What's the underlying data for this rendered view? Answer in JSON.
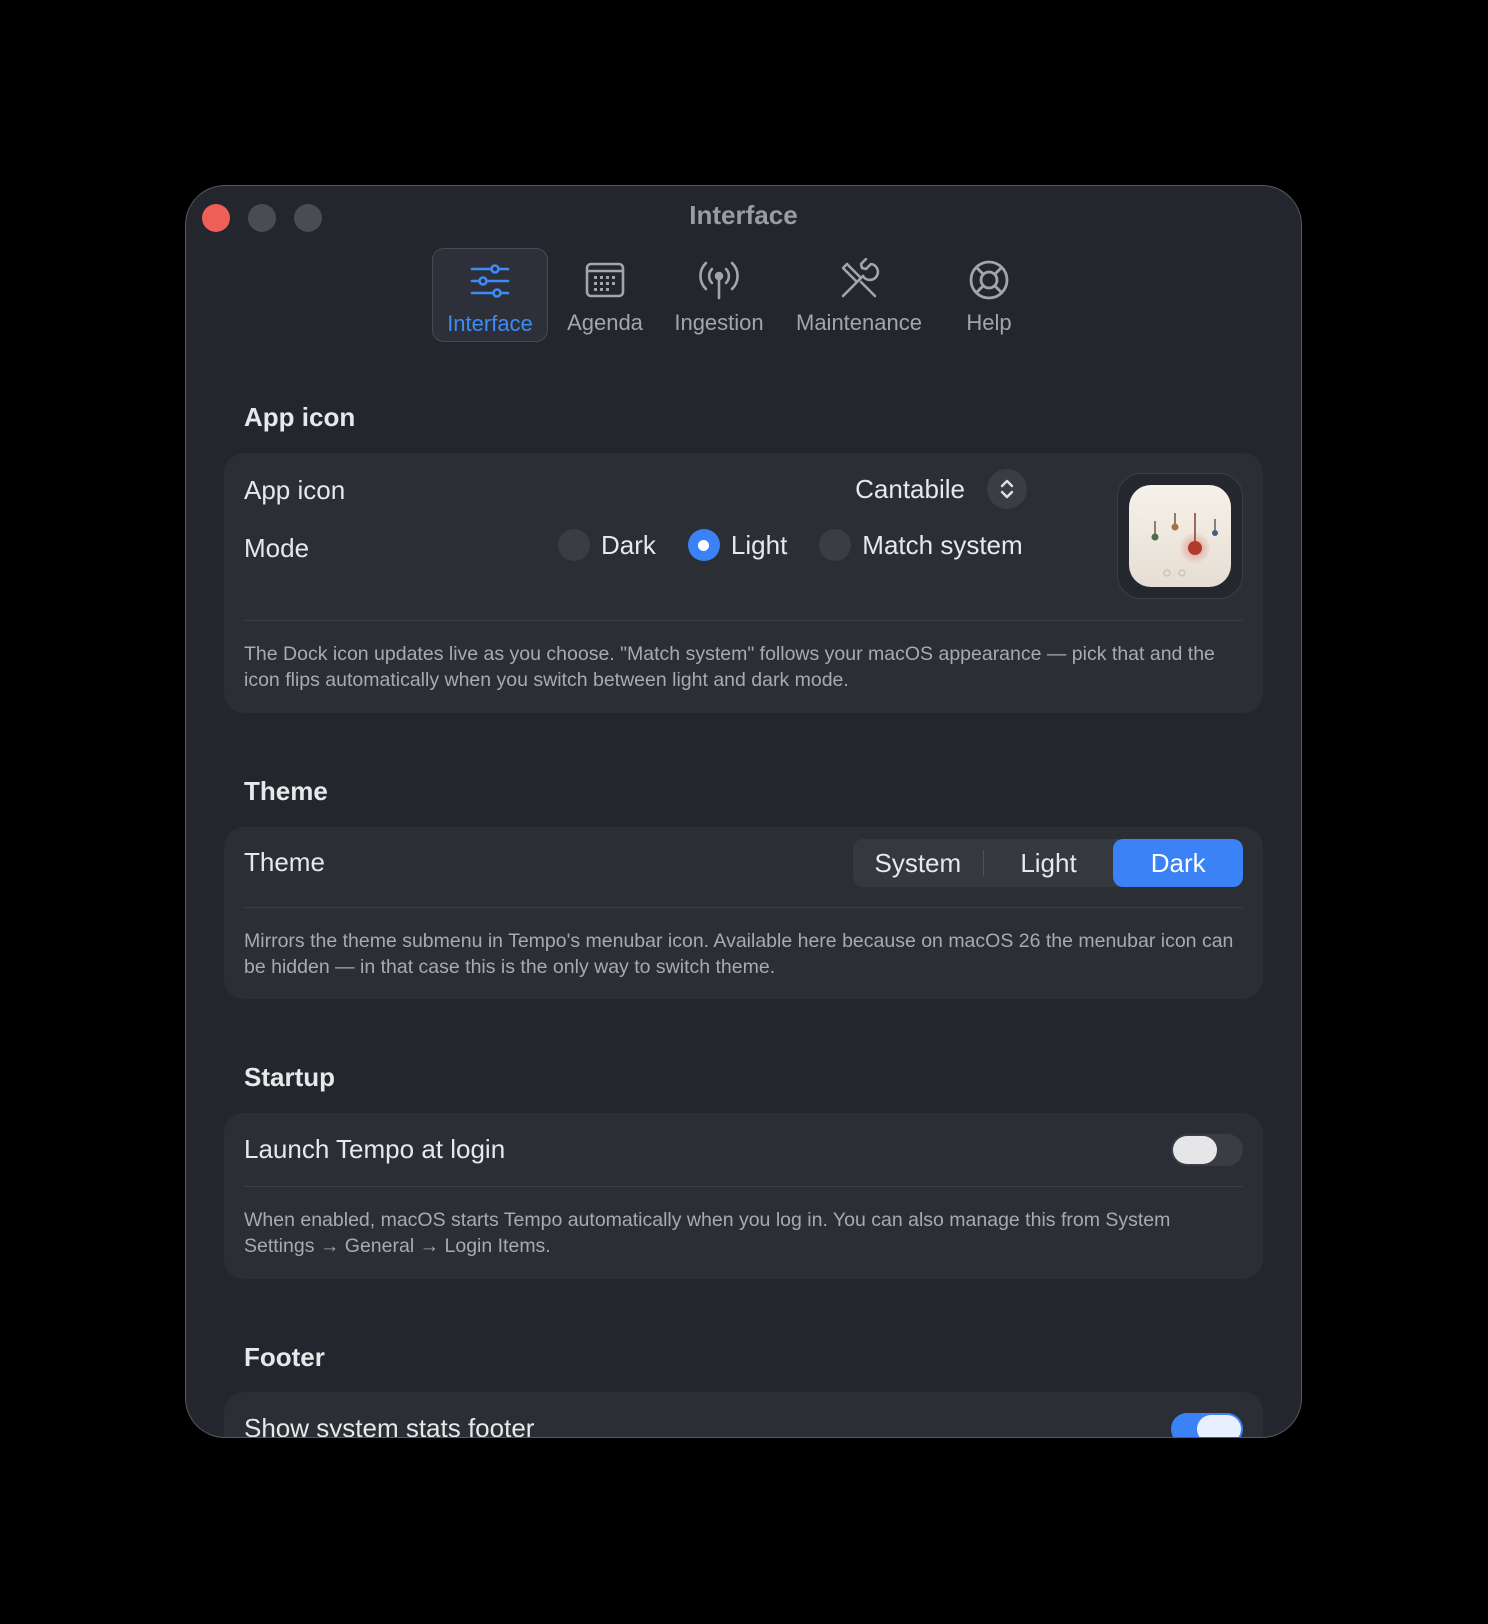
{
  "window": {
    "title": "Interface"
  },
  "toolbar": {
    "tabs": [
      {
        "label": "Interface",
        "icon": "sliders-icon",
        "active": true
      },
      {
        "label": "Agenda",
        "icon": "calendar-icon"
      },
      {
        "label": "Ingestion",
        "icon": "antenna-icon"
      },
      {
        "label": "Maintenance",
        "icon": "tools-icon"
      },
      {
        "label": "Help",
        "icon": "lifebuoy-icon"
      }
    ]
  },
  "app_icon": {
    "section_title": "App icon",
    "row_label": "App icon",
    "selected": "Cantabile",
    "mode_label": "Mode",
    "modes": [
      "Dark",
      "Light",
      "Match system"
    ],
    "selected_mode": "Light",
    "note": "The Dock icon updates live as you choose. \"Match system\" follows your macOS appearance — pick that and the icon flips automatically when you switch between light and dark mode."
  },
  "theme": {
    "section_title": "Theme",
    "row_label": "Theme",
    "options": [
      "System",
      "Light",
      "Dark"
    ],
    "selected": "Dark",
    "note": "Mirrors the theme submenu in Tempo's menubar icon. Available here because on macOS 26 the menubar icon can be hidden — in that case this is the only way to switch theme."
  },
  "startup": {
    "section_title": "Startup",
    "row_label": "Launch Tempo at login",
    "enabled": false,
    "note": "When enabled, macOS starts Tempo automatically when you log in. You can also manage this from System Settings → General → Login Items."
  },
  "footer": {
    "section_title": "Footer",
    "row_label": "Show system stats footer",
    "enabled": true
  },
  "colors": {
    "accent": "#3b82f6",
    "close": "#ee5f57"
  }
}
